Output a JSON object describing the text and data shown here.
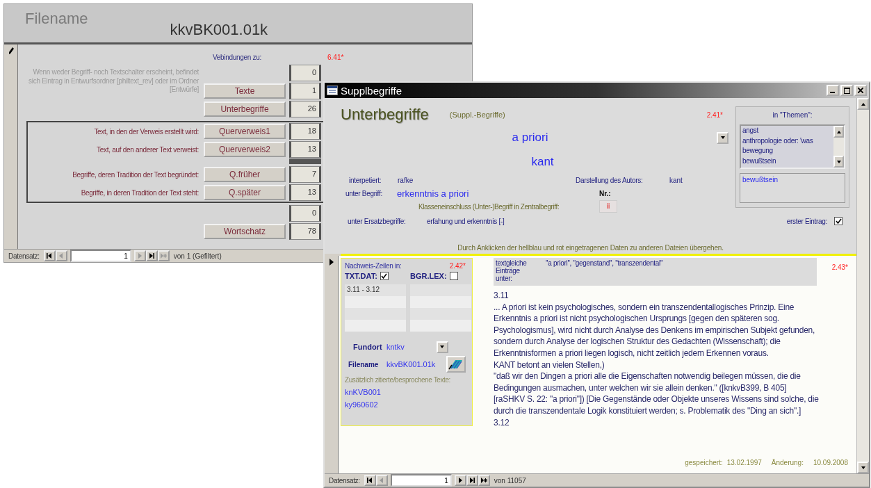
{
  "main_form": {
    "title_label": "Filename",
    "filename": "kkvBK001.01k",
    "connections_label": "Vebindungen zu:",
    "version": "6.41*",
    "note": "Wenn weder Begriff- noch Textschalter erscheint, befindet sich Eintrag in Entwurfsordner [philtext_rev] oder im Ordner [Entwürfe]",
    "top_rows": [
      {
        "count": "0"
      },
      {
        "button": "Texte",
        "count": "1"
      },
      {
        "button": "Unterbegriffe",
        "count": "26"
      }
    ],
    "reference_rows": [
      {
        "label": "Text, in den der Verweis erstellt wird:",
        "button": "Querverweis1",
        "count": "18"
      },
      {
        "label": "Text, auf den anderer Text verweist:",
        "button": "Querverweis2",
        "count": "13"
      }
    ],
    "tradition_rows": [
      {
        "label": "Begriffe, deren Tradition der Text begründet:",
        "button": "Q.früher",
        "count": "7"
      },
      {
        "label": "Begriffe, in deren Tradition der Text steht:",
        "button": "Q.später",
        "count": "13"
      }
    ],
    "bottom_rows": [
      {
        "count": "0"
      },
      {
        "button": "Wortschatz",
        "count": "78"
      }
    ],
    "navigation": {
      "label": "Datensatz:",
      "current": "1",
      "total": "von 1 (Gefiltert)",
      "buttons": [
        {
          "kind": "first",
          "disabled": false
        },
        {
          "kind": "previous",
          "disabled": true
        },
        {
          "kind": "next",
          "disabled": true
        },
        {
          "kind": "last",
          "disabled": false
        },
        {
          "kind": "new",
          "disabled": true
        }
      ]
    }
  },
  "suppl_window": {
    "title": "Supplbegriffe",
    "heading": "Unterbegriffe",
    "subheading": "(Suppl.-Begriffe)",
    "version": "2.41*",
    "term": "a priori",
    "author": "kant",
    "interpreted_label": "interpetiert:",
    "interpreted_value": "rafke",
    "presentation_label": "Darstellung des Autors:",
    "presentation_value": "kant",
    "parent_label": "unter Begriff:",
    "parent_value": "erkenntnis a priori",
    "number_label": "Nr.:",
    "class_label": "Klasseneinschluss (Unter-)Begriff in Zentralbegriff:",
    "class_value": "ii",
    "substitute_label": "unter Ersatzbegriffe:",
    "substitute_value": "erfahung und erkenntnis [-]",
    "first_entry_label": "erster Eintrag:",
    "first_entry_checked": true,
    "hint": "Durch Anklicken der hellblau und rot eingetragenen Daten zu anderen Dateien übergehen.",
    "themes": {
      "label": "in \"Themen\":",
      "items": [
        "angst",
        "anthropologie oder: 'was",
        "bewegung",
        "bewußtsein"
      ],
      "value": "bewußtsein"
    },
    "evidence": {
      "label": "Nachweis-Zeilen in:",
      "version": "2.42*",
      "sources": [
        {
          "label": "TXT.DAT:",
          "checked": true,
          "lines": [
            "3.11 - 3.12"
          ]
        },
        {
          "label": "BGR.LEX:",
          "checked": false
        }
      ],
      "location_label": "Fundort",
      "location_value": "kntkv",
      "filename_label": "Filename",
      "filename_value": "kkvBK001.01k",
      "cited_label": "Zusätzlich zitierte/besprochene Texte:",
      "cited": [
        "knKVB001",
        "ky960602"
      ]
    },
    "text_panel": {
      "equal_label": "textgleiche Einträge unter:",
      "equal_terms": "''a priori'', \"gegenstand\", \"transzendental\"",
      "version": "2.43*",
      "paragraphs": [
        "3.11",
        "... A priori ist kein psychologisches, sondern ein transzendentallogisches Prinzip. Eine Erkenntnis a priori ist nicht psychologischen Ursprungs [gegen den späteren sog. Psychologismus], wird nicht durch Analyse des Denkens im empirischen Subjekt gefunden, sondern durch Analyse der logischen Struktur des Gedachten (Wissenschaft); die Erkenntnisformen a priori liegen logisch, nicht zeitlich jedem Erkennen voraus.",
        "KANT betont an vielen Stellen,)",
        "\"daß wir den Dingen a priori alle die Eigenschaften notwendig beilegen müssen, die die Bedingungen ausmachen, unter welchen wir sie allein denken.\" ([knkvB399, B 405] [raSHKV S. 22: \"a priori\"]) [Die Gegenstände oder Objekte unseres Wissens sind solche, die durch die transzendentale Logik konstituiert werden; s. Problematik des \"Ding an sich\".]",
        "3.12"
      ],
      "saved_label": "gespeichert:",
      "saved_date": "13.02.1997",
      "changed_label": "Änderung:",
      "changed_date": "10.09.2008"
    },
    "navigation": {
      "label": "Datensatz:",
      "current": "1",
      "total": "von 11057",
      "buttons": [
        {
          "kind": "first",
          "disabled": false
        },
        {
          "kind": "previous",
          "disabled": true
        },
        {
          "kind": "next",
          "disabled": false
        },
        {
          "kind": "last",
          "disabled": false
        },
        {
          "kind": "new",
          "disabled": false
        }
      ]
    }
  }
}
